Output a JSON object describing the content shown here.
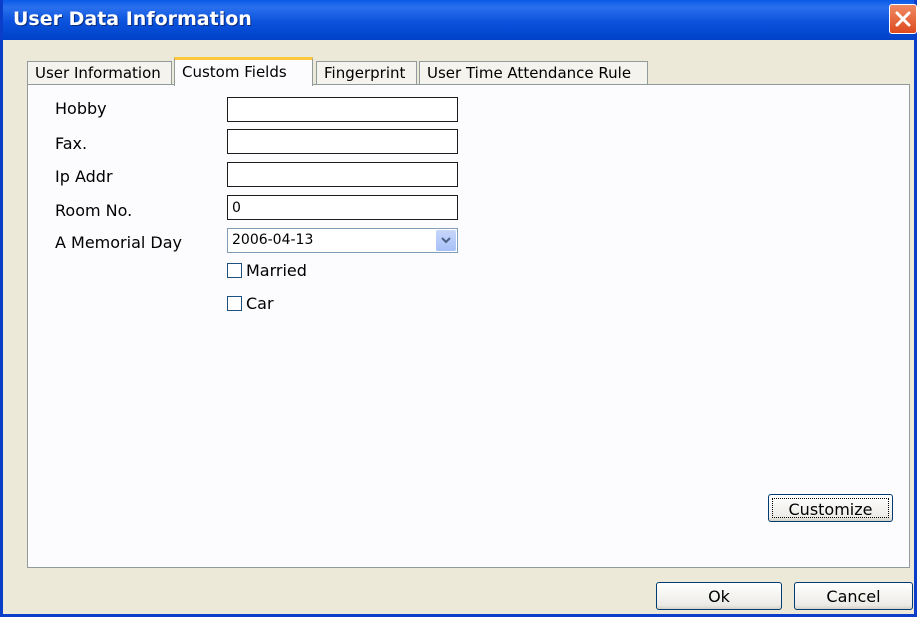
{
  "window": {
    "title": "User Data Information"
  },
  "tabs": [
    {
      "label": "User Information",
      "active": false
    },
    {
      "label": "Custom Fields",
      "active": true
    },
    {
      "label": "Fingerprint",
      "active": false
    },
    {
      "label": "User Time Attendance Rule",
      "active": false
    }
  ],
  "form": {
    "hobby": {
      "label": "Hobby",
      "value": ""
    },
    "fax": {
      "label": "Fax.",
      "value": ""
    },
    "ip_addr": {
      "label": "Ip Addr",
      "value": ""
    },
    "room_no": {
      "label": "Room No.",
      "value": "0"
    },
    "memorial_day": {
      "label": "A Memorial Day",
      "value": "2006-04-13"
    },
    "married": {
      "label": "Married",
      "checked": false
    },
    "car": {
      "label": "Car",
      "checked": false
    }
  },
  "buttons": {
    "customize": "Customize",
    "ok": "Ok",
    "cancel": "Cancel"
  },
  "icons": {
    "close": "close-icon",
    "dropdown": "chevron-down-icon"
  },
  "colors": {
    "titlebar": "#0a52dc",
    "active_tab_accent": "#ffc83c",
    "close_button": "#dd4a1e"
  }
}
